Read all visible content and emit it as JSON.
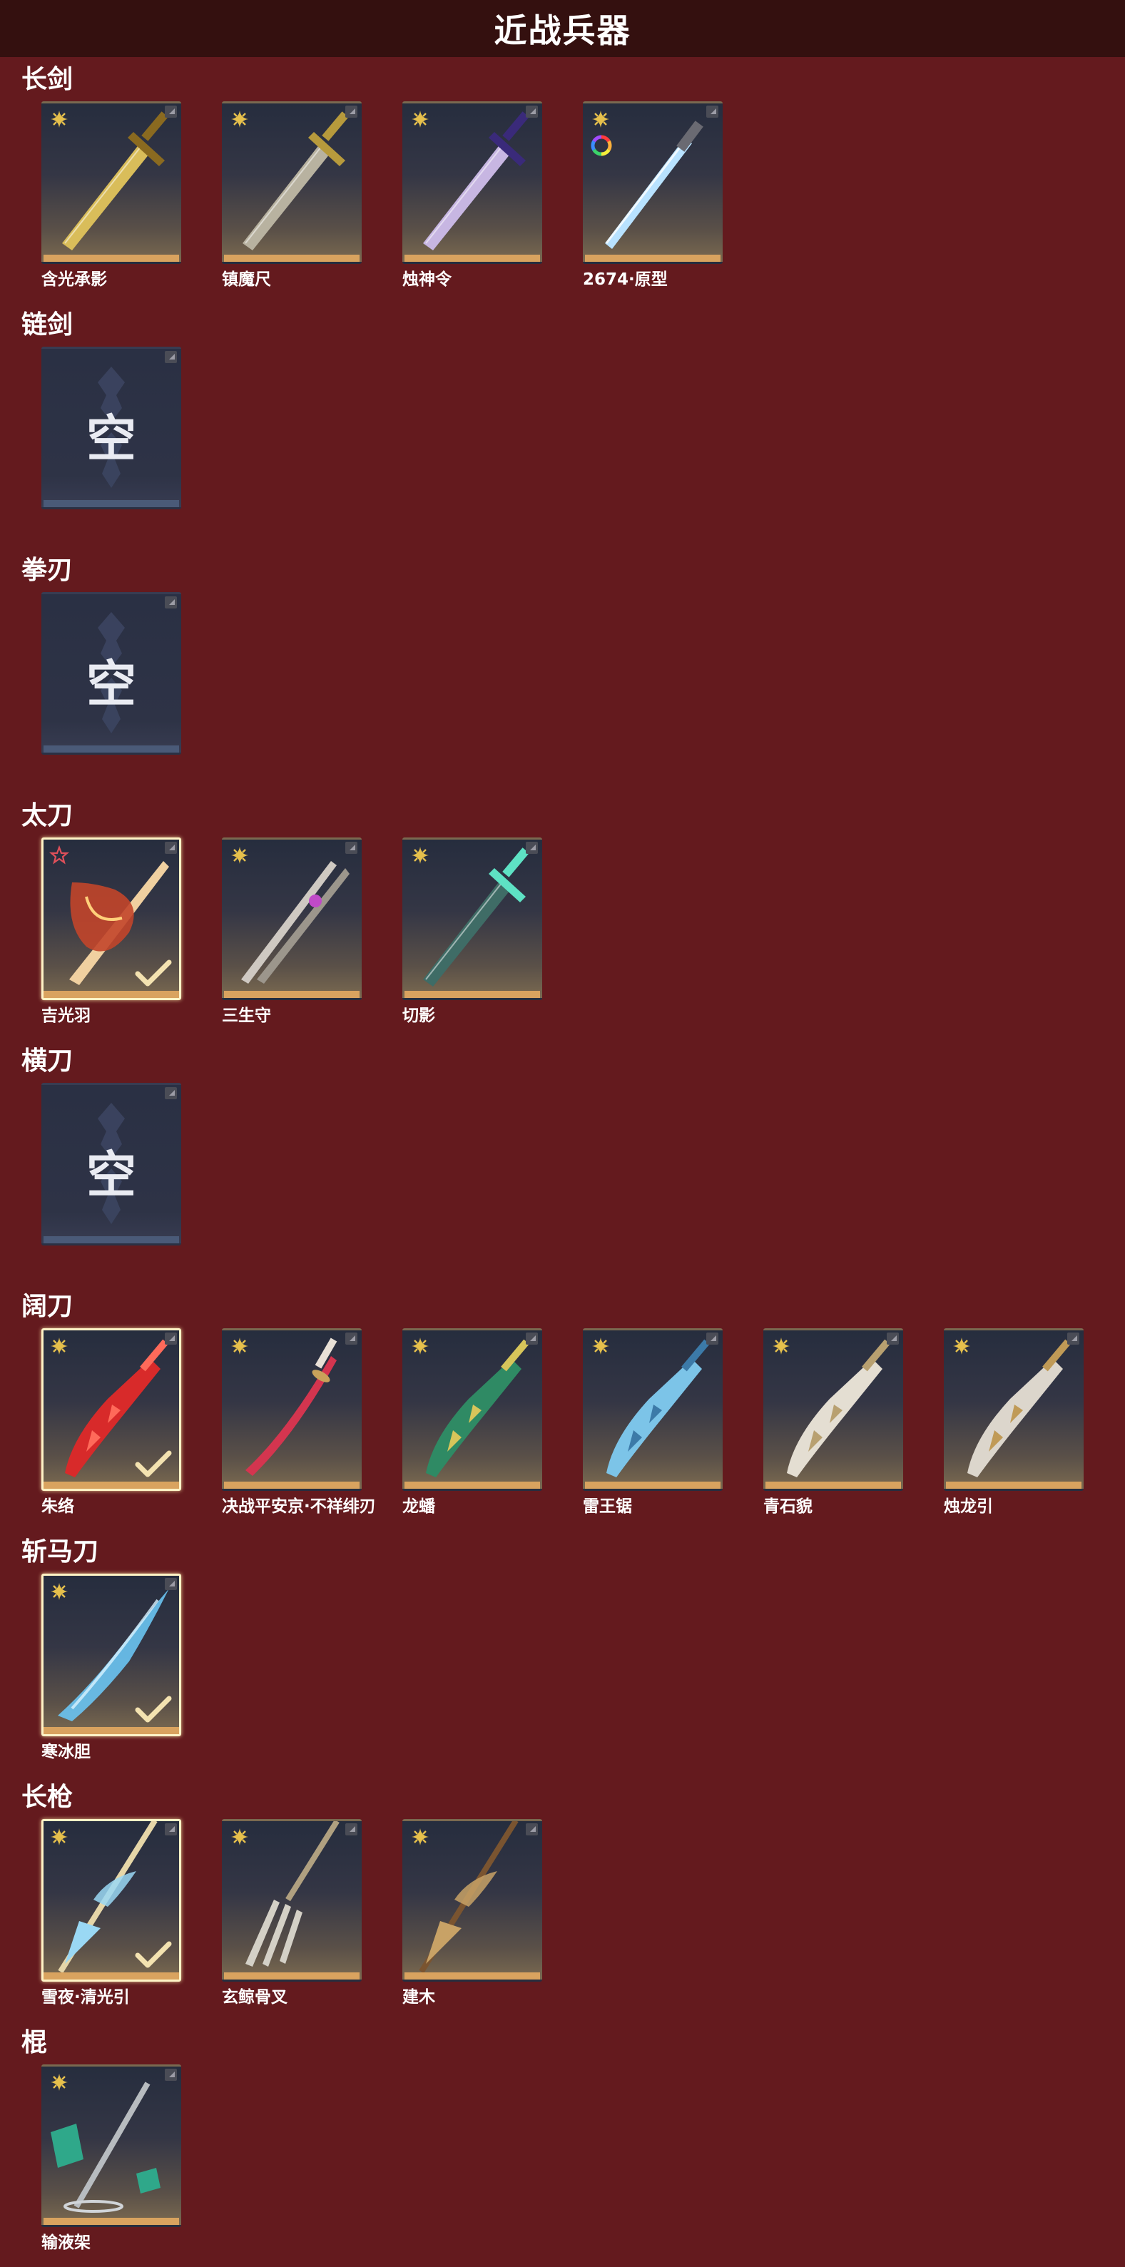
{
  "page_title": "近战兵器",
  "empty_label": "空",
  "categories": [
    {
      "title": "长剑",
      "items": [
        {
          "name": "含光承影",
          "rarity": "gold",
          "selected": false,
          "ring": false,
          "weapon": {
            "style": "sword",
            "blade": "#d9bd5a",
            "accent": "#8a6a20"
          }
        },
        {
          "name": "镇魔尺",
          "rarity": "gold",
          "selected": false,
          "ring": false,
          "weapon": {
            "style": "sword",
            "blade": "#b8b2a0",
            "accent": "#b79a3c"
          }
        },
        {
          "name": "烛神令",
          "rarity": "gold",
          "selected": false,
          "ring": false,
          "weapon": {
            "style": "sword",
            "blade": "#c7b6e2",
            "accent": "#3a2a7a"
          }
        },
        {
          "name": "2674·原型",
          "rarity": "gold",
          "selected": false,
          "ring": true,
          "weapon": {
            "style": "saber",
            "blade": "#b8e2ff",
            "accent": "#6a6a72"
          }
        }
      ]
    },
    {
      "title": "链剑",
      "items": []
    },
    {
      "title": "拳刃",
      "items": []
    },
    {
      "title": "太刀",
      "items": [
        {
          "name": "吉光羽",
          "rarity": "red",
          "selected": true,
          "ring": false,
          "weapon": {
            "style": "feather",
            "blade": "#f0d0a0",
            "accent": "#c2452a"
          }
        },
        {
          "name": "三生守",
          "rarity": "gold",
          "selected": false,
          "ring": false,
          "weapon": {
            "style": "twin",
            "blade": "#cfc9c2",
            "accent": "#c04ac8"
          }
        },
        {
          "name": "切影",
          "rarity": "gold",
          "selected": false,
          "ring": false,
          "weapon": {
            "style": "sword",
            "blade": "#3f6c66",
            "accent": "#5ee2c4"
          }
        }
      ]
    },
    {
      "title": "横刀",
      "items": []
    },
    {
      "title": "阔刀",
      "items": [
        {
          "name": "朱络",
          "rarity": "gold",
          "selected": true,
          "ring": false,
          "weapon": {
            "style": "broad",
            "blade": "#d82a2a",
            "accent": "#ff6a5a"
          }
        },
        {
          "name": "决战平安京·不祥绯刃",
          "rarity": "gold",
          "selected": false,
          "ring": false,
          "weapon": {
            "style": "katana",
            "blade": "#d4354f",
            "accent": "#e8e0d6"
          }
        },
        {
          "name": "龙蟠",
          "rarity": "gold",
          "selected": false,
          "ring": false,
          "weapon": {
            "style": "broad",
            "blade": "#2f8a64",
            "accent": "#d7c55a"
          }
        },
        {
          "name": "雷王锯",
          "rarity": "gold",
          "selected": false,
          "ring": false,
          "weapon": {
            "style": "broad",
            "blade": "#7cc4e8",
            "accent": "#3c7aa8"
          }
        },
        {
          "name": "青石貌",
          "rarity": "gold",
          "selected": false,
          "ring": false,
          "weapon": {
            "style": "broad",
            "blade": "#e4ded2",
            "accent": "#b8a070"
          }
        },
        {
          "name": "烛龙引",
          "rarity": "gold",
          "selected": false,
          "ring": false,
          "weapon": {
            "style": "broad",
            "blade": "#dcd6cc",
            "accent": "#c09a56"
          }
        }
      ]
    },
    {
      "title": "斩马刀",
      "items": [
        {
          "name": "寒冰胆",
          "rarity": "gold",
          "selected": true,
          "ring": false,
          "weapon": {
            "style": "ice",
            "blade": "#6ac4f2",
            "accent": "#d8f2ff"
          }
        }
      ]
    },
    {
      "title": "长枪",
      "items": [
        {
          "name": "雪夜·清光引",
          "rarity": "gold",
          "selected": true,
          "ring": false,
          "weapon": {
            "style": "spear",
            "blade": "#9ad8f4",
            "accent": "#e6d6a8"
          }
        },
        {
          "name": "玄鲸骨叉",
          "rarity": "gold",
          "selected": false,
          "ring": false,
          "weapon": {
            "style": "trident",
            "blade": "#d4d0c6",
            "accent": "#b0a080"
          }
        },
        {
          "name": "建木",
          "rarity": "gold",
          "selected": false,
          "ring": false,
          "weapon": {
            "style": "spear",
            "blade": "#c8a266",
            "accent": "#7a5430"
          }
        }
      ]
    },
    {
      "title": "棍",
      "items": [
        {
          "name": "输液架",
          "rarity": "gold",
          "selected": false,
          "ring": false,
          "weapon": {
            "style": "pole",
            "blade": "#b8bcc0",
            "accent": "#2fa88a"
          }
        }
      ]
    }
  ]
}
